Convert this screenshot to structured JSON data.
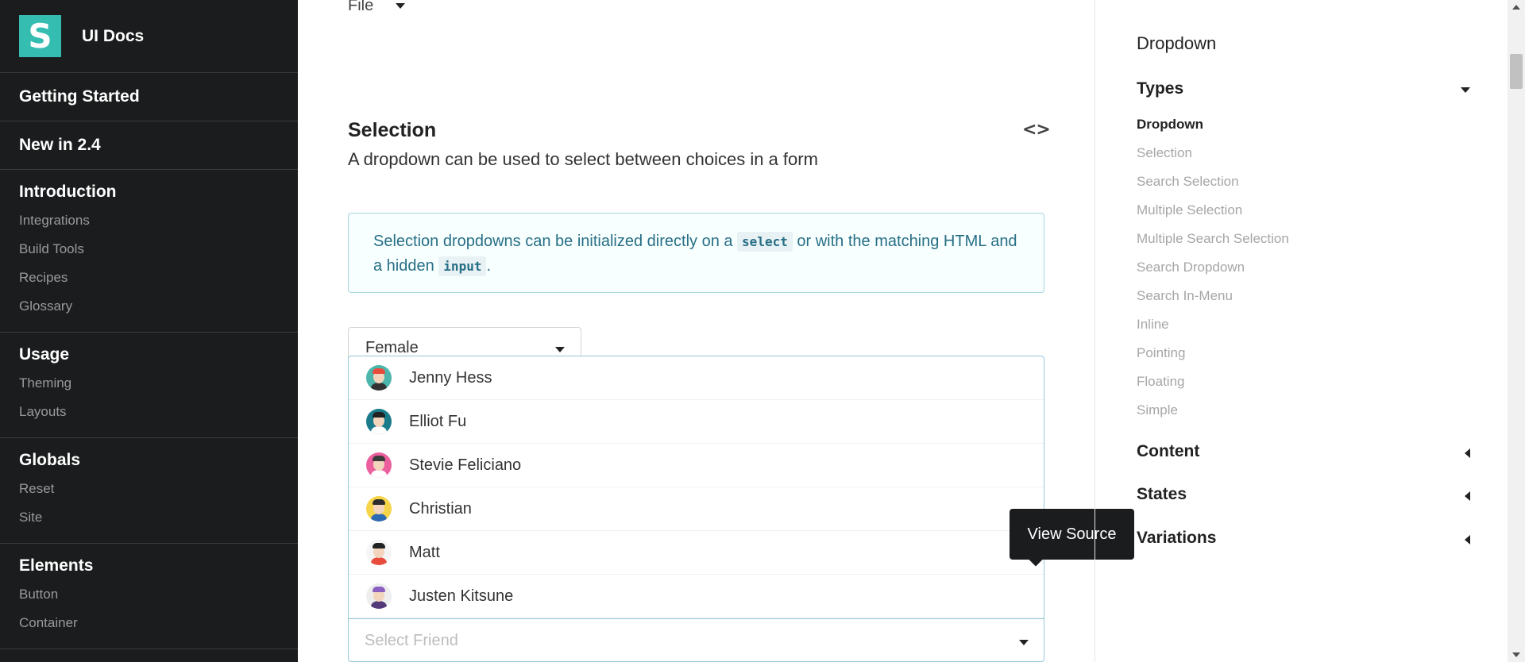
{
  "brand": {
    "logo_letter": "S",
    "title": "UI Docs",
    "logo_color": "#35bdb2"
  },
  "sidebar": {
    "sections": [
      {
        "label": "Getting Started",
        "items": []
      },
      {
        "label": "New in 2.4",
        "items": []
      },
      {
        "label": "Introduction",
        "items": [
          "Integrations",
          "Build Tools",
          "Recipes",
          "Glossary"
        ]
      },
      {
        "label": "Usage",
        "items": [
          "Theming",
          "Layouts"
        ]
      },
      {
        "label": "Globals",
        "items": [
          "Reset",
          "Site"
        ]
      },
      {
        "label": "Elements",
        "items": [
          "Button",
          "Container"
        ]
      }
    ]
  },
  "main": {
    "file_label": "File",
    "section_title": "Selection",
    "section_description": "A dropdown can be used to select between choices in a form",
    "info": {
      "text_1": "Selection dropdowns can be initialized directly on a ",
      "code_1": "select",
      "text_2": " or with the matching HTML and a hidden ",
      "code_2": "input",
      "text_3": "."
    },
    "gender_select": {
      "value": "Female"
    },
    "friend_menu": {
      "items": [
        {
          "name": "Jenny Hess",
          "avatar": "jenny-avatar-icon",
          "bg": "#4db6ac",
          "shirt": "#333",
          "hair": "#e84c3d"
        },
        {
          "name": "Elliot Fu",
          "avatar": "elliot-avatar-icon",
          "bg": "#1a7c8a",
          "shirt": "#ffffff",
          "hair": "#222222"
        },
        {
          "name": "Stevie Feliciano",
          "avatar": "stevie-avatar-icon",
          "bg": "#ec5f9e",
          "shirt": "#ffffff",
          "hair": "#3a3a3a"
        },
        {
          "name": "Christian",
          "avatar": "christian-avatar-icon",
          "bg": "#f7d54a",
          "shirt": "#2d6ab4",
          "hair": "#2d2d2d"
        },
        {
          "name": "Matt",
          "avatar": "matt-avatar-icon",
          "bg": "#f5f5f5",
          "shirt": "#e84c3d",
          "hair": "#222222"
        },
        {
          "name": "Justen Kitsune",
          "avatar": "justen-avatar-icon",
          "bg": "#eeeeee",
          "shirt": "#553a7a",
          "hair": "#8b5fbf"
        }
      ]
    },
    "friend_select": {
      "placeholder": "Select Friend"
    },
    "tooltip": "View Source"
  },
  "toc": {
    "title": "Dropdown",
    "groups": [
      {
        "label": "Types",
        "expanded": true
      },
      {
        "label": "Content",
        "expanded": false
      },
      {
        "label": "States",
        "expanded": false
      },
      {
        "label": "Variations",
        "expanded": false
      }
    ],
    "types_items": [
      "Dropdown",
      "Selection",
      "Search Selection",
      "Multiple Selection",
      "Multiple Search Selection",
      "Search Dropdown",
      "Search In-Menu",
      "Inline",
      "Pointing",
      "Floating",
      "Simple"
    ],
    "active_item": "Dropdown"
  }
}
